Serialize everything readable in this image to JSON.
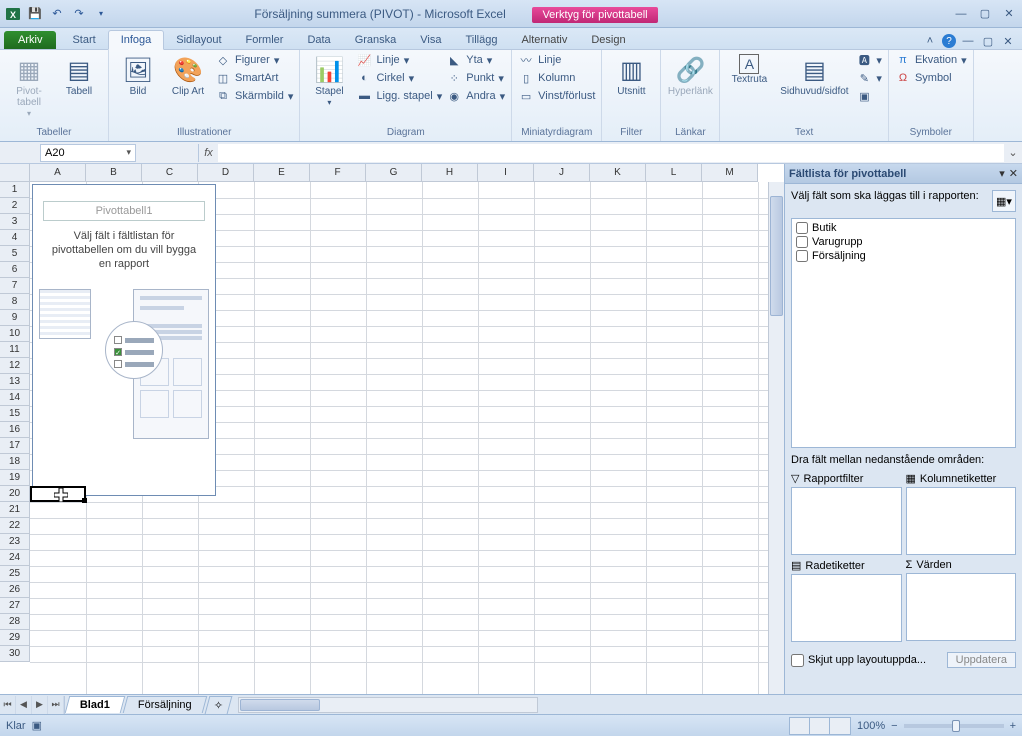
{
  "title": "Försäljning summera (PIVOT)  -  Microsoft Excel",
  "context_tab": "Verktyg för pivottabell",
  "file_tab": "Arkiv",
  "tabs": [
    "Start",
    "Infoga",
    "Sidlayout",
    "Formler",
    "Data",
    "Granska",
    "Visa",
    "Tillägg",
    "Alternativ",
    "Design"
  ],
  "active_tab": "Infoga",
  "ribbon": {
    "tables": {
      "pivot": "Pivot-\ntabell",
      "table": "Tabell",
      "label": "Tabeller"
    },
    "illustrations": {
      "pic": "Bild",
      "clip": "Clip\nArt",
      "shapes": "Figurer",
      "smartart": "SmartArt",
      "screenshot": "Skärmbild",
      "label": "Illustrationer"
    },
    "charts": {
      "column": "Stapel",
      "line": "Linje",
      "pie": "Cirkel",
      "bar": "Ligg. stapel",
      "area": "Yta",
      "scatter": "Punkt",
      "other": "Andra",
      "label": "Diagram"
    },
    "sparklines": {
      "line": "Linje",
      "column": "Kolumn",
      "winloss": "Vinst/förlust",
      "label": "Miniatyrdiagram"
    },
    "filter": {
      "slicer": "Utsnitt",
      "label": "Filter"
    },
    "links": {
      "hyperlink": "Hyperlänk",
      "label": "Länkar"
    },
    "text": {
      "textbox": "Textruta",
      "headerfooter": "Sidhuvud/sidfot",
      "label": "Text"
    },
    "symbols": {
      "equation": "Ekvation",
      "symbol": "Symbol",
      "label": "Symboler"
    }
  },
  "namebox": "A20",
  "fx": "fx",
  "columns": [
    "A",
    "B",
    "C",
    "D",
    "E",
    "F",
    "G",
    "H",
    "I",
    "J",
    "K",
    "L",
    "M"
  ],
  "rows": 30,
  "pivot_placeholder": {
    "title": "Pivottabell1",
    "msg": "Välj fält i fältlistan för pivottabellen om du vill bygga en rapport"
  },
  "field_panel": {
    "title": "Fältlista för pivottabell",
    "prompt": "Välj fält som ska läggas till i rapporten:",
    "fields": [
      "Butik",
      "Varugrupp",
      "Försäljning"
    ],
    "drag_prompt": "Dra fält mellan nedanstående områden:",
    "areas": {
      "filter": "Rapportfilter",
      "cols": "Kolumnetiketter",
      "rows": "Radetiketter",
      "values": "Värden"
    },
    "defer": "Skjut upp layoutuppda...",
    "update": "Uppdatera"
  },
  "sheet_tabs": [
    "Blad1",
    "Försäljning"
  ],
  "active_sheet": "Blad1",
  "status": {
    "ready": "Klar",
    "zoom": "100%"
  }
}
